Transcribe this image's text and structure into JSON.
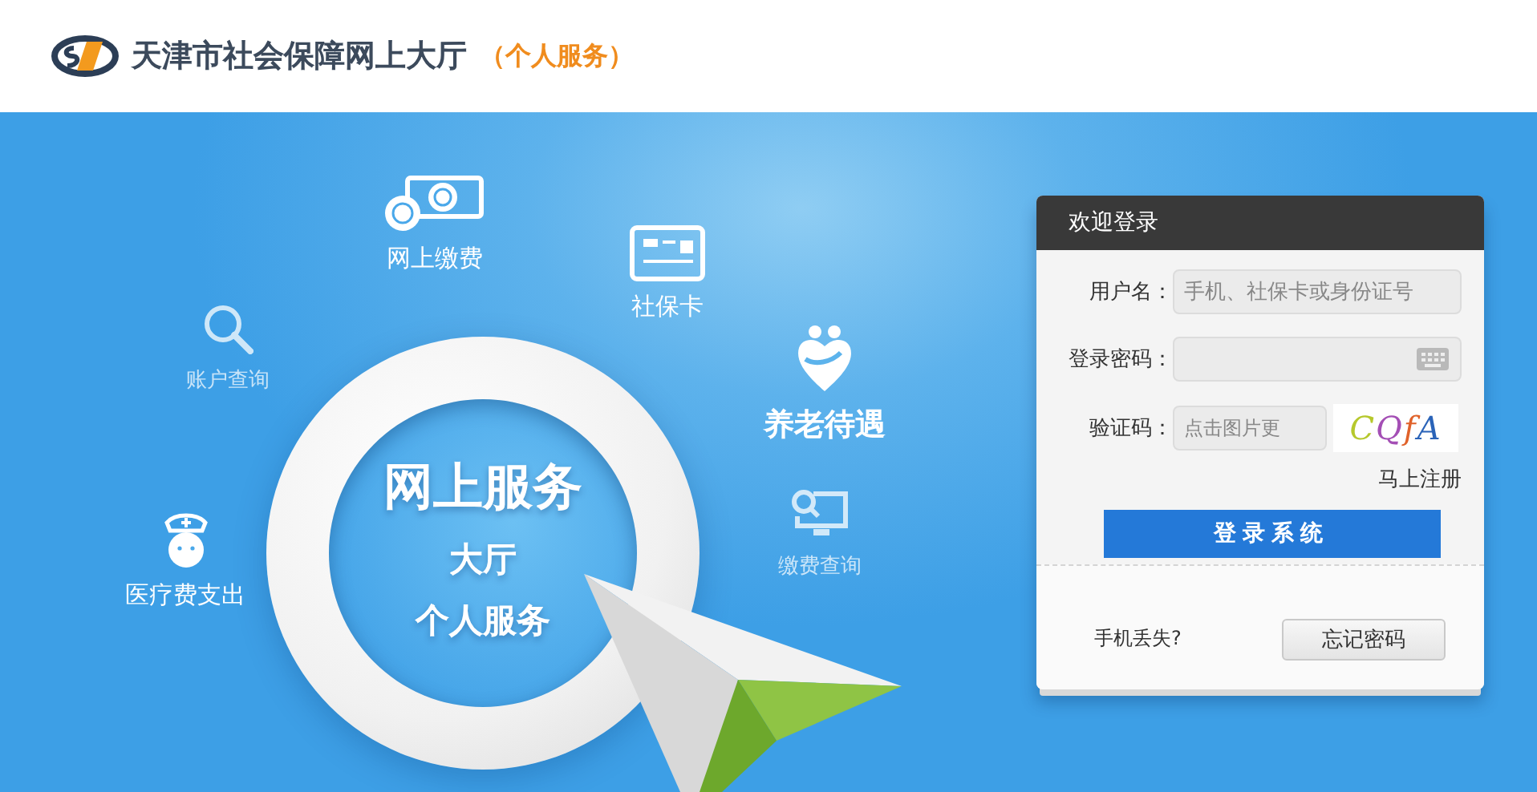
{
  "header": {
    "title": "天津市社会保障网上大厅",
    "subtitle": "（个人服务）"
  },
  "hero": {
    "lines": [
      "网上服务",
      "大厅",
      "个人服务"
    ]
  },
  "services": [
    {
      "kind": "payment",
      "label": "网上缴费"
    },
    {
      "kind": "card",
      "label": "社保卡"
    },
    {
      "kind": "account",
      "label": "账户查询"
    },
    {
      "kind": "pension",
      "label": "养老待遇"
    },
    {
      "kind": "fee-query",
      "label": "缴费查询"
    },
    {
      "kind": "medical",
      "label": "医疗费支出"
    }
  ],
  "login": {
    "title": "欢迎登录",
    "fields": [
      {
        "kind": "text",
        "label": "用户名：",
        "placeholder": "手机、社保卡或身份证号"
      },
      {
        "kind": "password",
        "label": "登录密码："
      },
      {
        "kind": "captcha",
        "label": "验证码：",
        "placeholder": "点击图片更",
        "captcha": "CQfA"
      }
    ],
    "register_link": "马上注册",
    "submit": "登录系统",
    "lost_phone": "手机丢失?",
    "forgot": "忘记密码"
  }
}
